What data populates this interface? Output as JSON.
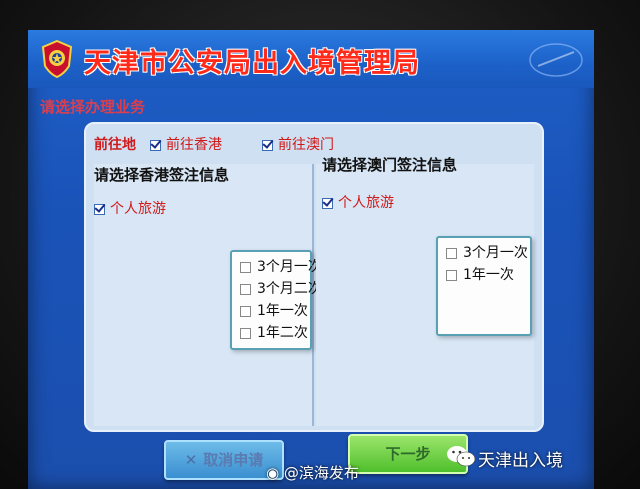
{
  "header": {
    "org_title": "天津市公安局出入境管理局",
    "subtitle": "请选择办理业务"
  },
  "destination": {
    "label": "前往地",
    "options": [
      {
        "label": "前往香港",
        "checked": true
      },
      {
        "label": "前往澳门",
        "checked": true
      }
    ]
  },
  "hongkong": {
    "title": "请选择香港签注信息",
    "category": {
      "label": "个人旅游",
      "checked": true
    },
    "endorsements": [
      {
        "label": "3个月一次",
        "checked": false
      },
      {
        "label": "3个月二次",
        "checked": false
      },
      {
        "label": "1年一次",
        "checked": false
      },
      {
        "label": "1年二次",
        "checked": false
      }
    ]
  },
  "macau": {
    "title": "请选择澳门签注信息",
    "category": {
      "label": "个人旅游",
      "checked": true
    },
    "endorsements": [
      {
        "label": "3个月一次",
        "checked": false
      },
      {
        "label": "1年一次",
        "checked": false
      }
    ]
  },
  "buttons": {
    "cancel": "取消申请",
    "next": "下一步"
  },
  "watermarks": {
    "weibo": "@滨海发布",
    "wechat": "天津出入境"
  },
  "colors": {
    "screen_blue": "#1e5fc7",
    "title_red": "#ff2a1a",
    "panel_bg": "#cfe0f3",
    "next_green": "#4fbf2c",
    "cancel_blue": "#3a8fd0"
  }
}
